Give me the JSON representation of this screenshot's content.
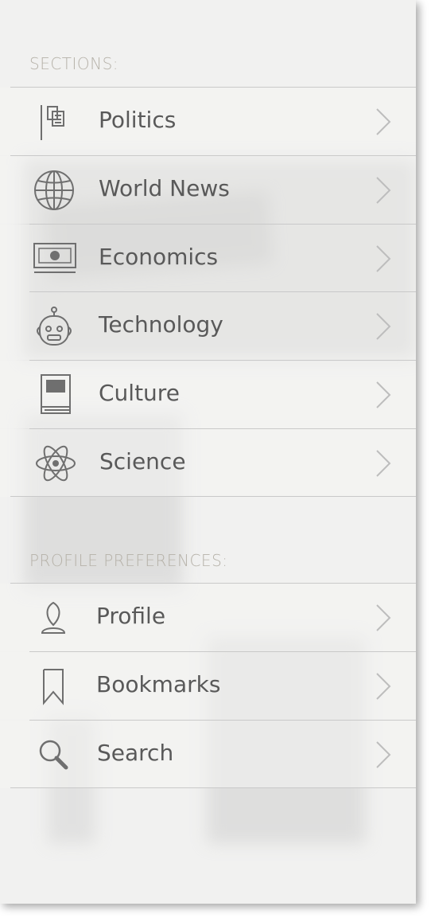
{
  "sections_title": "SECTIONS:",
  "sections": [
    {
      "label": "Politics",
      "icon": "politics-icon"
    },
    {
      "label": "World News",
      "icon": "globe-icon"
    },
    {
      "label": "Economics",
      "icon": "banknote-icon"
    },
    {
      "label": "Technology",
      "icon": "robot-icon"
    },
    {
      "label": "Culture",
      "icon": "book-icon"
    },
    {
      "label": "Science",
      "icon": "atom-icon"
    }
  ],
  "profile_title": "PROFILE PREFERENCES:",
  "profile_items": [
    {
      "label": "Profile",
      "icon": "user-icon"
    },
    {
      "label": "Bookmarks",
      "icon": "bookmark-icon"
    },
    {
      "label": "Search",
      "icon": "search-icon"
    }
  ],
  "colors": {
    "panel": "#f1f1f0",
    "section_title": "#b6b2a9",
    "label": "#595959",
    "icon": "#6f6f6f",
    "chevron": "#bdbdbd",
    "divider": "#c9c9c9"
  }
}
